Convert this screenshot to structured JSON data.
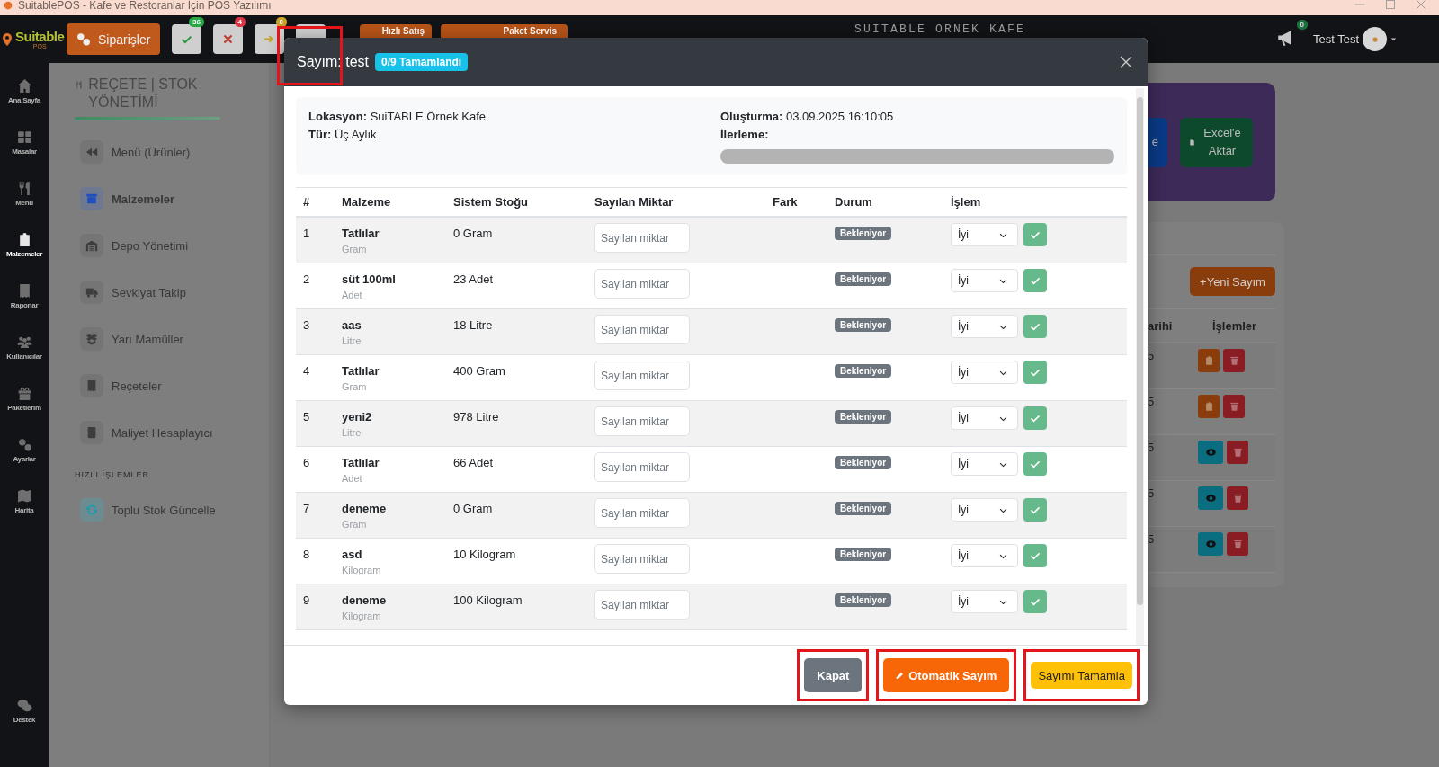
{
  "window": {
    "title": "SuitablePOS - Kafe ve Restoranlar İçin POS Yazılımı"
  },
  "topbar": {
    "logo": "Suitable",
    "logo_sub": "POS",
    "orders_button": "Siparişler",
    "status_buttons": [
      {
        "kind": "check",
        "count": "36",
        "color": "#28a745"
      },
      {
        "kind": "cross",
        "count": "4",
        "color": "#dc3545"
      },
      {
        "kind": "arrow",
        "count": "0",
        "color": "#c9a227"
      },
      {
        "kind": "blank"
      }
    ],
    "quick_sale": "Hızlı Satış",
    "package_service": "Paket Servis",
    "cafe_name": "SUITABLE ORNEK KAFE",
    "notifications": "0",
    "user": "Test Test"
  },
  "rail": [
    {
      "label": "Ana Sayfa",
      "selected": false
    },
    {
      "label": "Masalar",
      "selected": false
    },
    {
      "label": "Menu",
      "selected": false
    },
    {
      "label": "Malzemeler",
      "selected": true
    },
    {
      "label": "Raporlar",
      "selected": false
    },
    {
      "label": "Kullanıcılar",
      "selected": false
    },
    {
      "label": "Paketlerim",
      "selected": false
    },
    {
      "label": "Ayarlar",
      "selected": false
    },
    {
      "label": "Harita",
      "selected": false
    },
    {
      "label": "Destek",
      "selected": false
    }
  ],
  "sidebar": {
    "title": "REÇETE | STOK YÖNETİMİ",
    "items": [
      {
        "label": "Menü (Ürünler)",
        "selected": false
      },
      {
        "label": "Malzemeler",
        "selected": true
      },
      {
        "label": "Depo Yönetimi",
        "selected": false
      },
      {
        "label": "Sevkiyat Takip",
        "selected": false
      },
      {
        "label": "Yarı Mamüller",
        "selected": false
      },
      {
        "label": "Reçeteler",
        "selected": false
      },
      {
        "label": "Maliyet Hesaplayıcı",
        "selected": false
      }
    ],
    "section": "HIZLI İŞLEMLER",
    "quick_items": [
      {
        "label": "Toplu Stok Güncelle"
      }
    ]
  },
  "main": {
    "action_buttons": [
      {
        "kind": "partial",
        "label": "e"
      },
      {
        "kind": "excel",
        "label": "Excel'e Aktar"
      }
    ],
    "new_count_button": "+Yeni Sayım",
    "columns": [
      "arihi",
      "İşlemler"
    ],
    "rows": [
      {
        "date": "5",
        "kind": "approve"
      },
      {
        "date": "5",
        "kind": "approve"
      },
      {
        "date": "5",
        "kind": "view"
      },
      {
        "date": "5",
        "kind": "view"
      },
      {
        "date": "5",
        "kind": "view"
      }
    ]
  },
  "modal": {
    "title": "Sayım: test",
    "highlighted": true,
    "badge": "0/9 Tamamlandı",
    "info": {
      "location_label": "Lokasyon:",
      "location": "SuiTABLE Örnek Kafe",
      "type_label": "Tür:",
      "type": "Üç Aylık",
      "created_label": "Oluşturma:",
      "created": "03.09.2025 16:10:05",
      "progress_label": "İlerleme:",
      "level": 0
    },
    "columns": [
      "#",
      "Malzeme",
      "Sistem Stoğu",
      "Sayılan Miktar",
      "Fark",
      "Durum",
      "İşlem"
    ],
    "rows": [
      {
        "no": "1",
        "name": "Tatlılar",
        "unit": "Gram",
        "stock": "0 Gram",
        "placeholder": "Sayılan miktar",
        "status": "Bekleniyor",
        "condition": "İyi"
      },
      {
        "no": "2",
        "name": "süt 100ml",
        "unit": "Adet",
        "stock": "23 Adet",
        "placeholder": "Sayılan miktar",
        "status": "Bekleniyor",
        "condition": "İyi"
      },
      {
        "no": "3",
        "name": "aas",
        "unit": "Litre",
        "stock": "18 Litre",
        "placeholder": "Sayılan miktar",
        "status": "Bekleniyor",
        "condition": "İyi"
      },
      {
        "no": "4",
        "name": "Tatlılar",
        "unit": "Gram",
        "stock": "400 Gram",
        "placeholder": "Sayılan miktar",
        "status": "Bekleniyor",
        "condition": "İyi"
      },
      {
        "no": "5",
        "name": "yeni2",
        "unit": "Litre",
        "stock": "978 Litre",
        "placeholder": "Sayılan miktar",
        "status": "Bekleniyor",
        "condition": "İyi"
      },
      {
        "no": "6",
        "name": "Tatlılar",
        "unit": "Adet",
        "stock": "66 Adet",
        "placeholder": "Sayılan miktar",
        "status": "Bekleniyor",
        "condition": "İyi"
      },
      {
        "no": "7",
        "name": "deneme",
        "unit": "Gram",
        "stock": "0 Gram",
        "placeholder": "Sayılan miktar",
        "status": "Bekleniyor",
        "condition": "İyi"
      },
      {
        "no": "8",
        "name": "asd",
        "unit": "Kilogram",
        "stock": "10 Kilogram",
        "placeholder": "Sayılan miktar",
        "status": "Bekleniyor",
        "condition": "İyi"
      },
      {
        "no": "9",
        "name": "deneme",
        "unit": "Kilogram",
        "stock": "100 Kilogram",
        "placeholder": "Sayılan miktar",
        "status": "Bekleniyor",
        "condition": "İyi"
      }
    ],
    "buttons": [
      {
        "kind": "close",
        "label": "Kapat",
        "highlighted": true
      },
      {
        "kind": "auto",
        "label": "Otomatik Sayım",
        "highlighted": true
      },
      {
        "kind": "complete",
        "label": "Sayımı Tamamla",
        "highlighted": true
      }
    ]
  }
}
